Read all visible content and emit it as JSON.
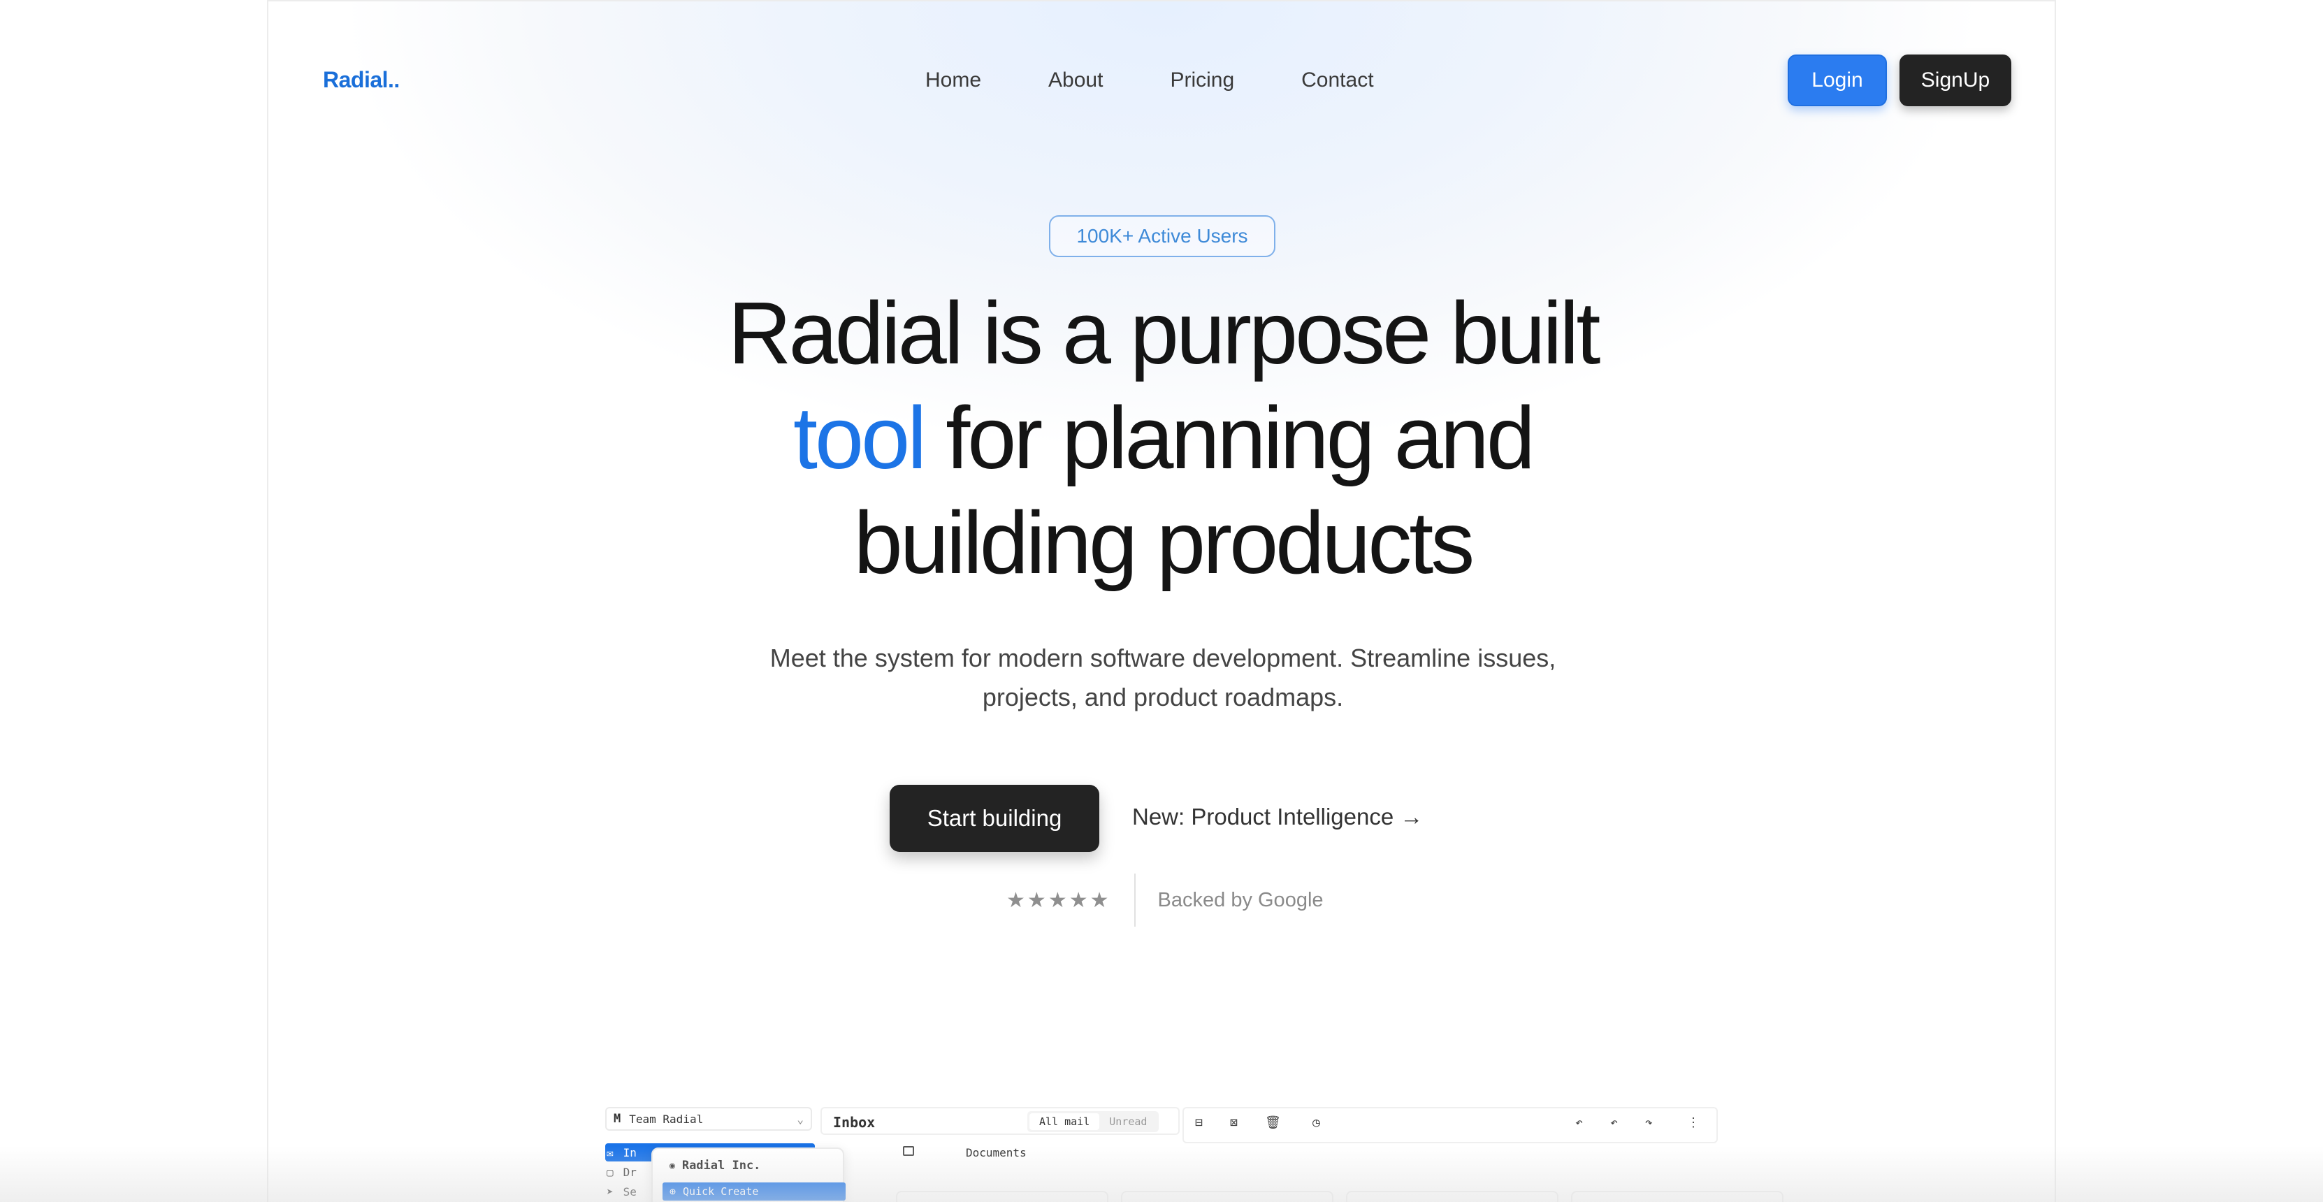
{
  "brand": {
    "logo": "Radial..",
    "accent": "#1c74e6"
  },
  "nav": {
    "links": [
      "Home",
      "About",
      "Pricing",
      "Contact"
    ],
    "login_label": "Login",
    "signup_label": "SignUp"
  },
  "hero": {
    "badge": "100K+ Active Users",
    "headline_line1": "Radial is a purpose built",
    "headline_accent": "tool",
    "headline_line2_rest": " for planning and",
    "headline_line3": "building products",
    "subtext": "Meet the system for modern software development. Streamline issues, projects, and product roadmaps.",
    "cta_primary": "Start building",
    "cta_secondary": "New: Product Intelligence →",
    "rating_stars": 5,
    "backed_by": "Backed by Google"
  },
  "preview": {
    "team_name": "Team Radial",
    "sidebar_items": [
      "In",
      "Dr",
      "Se"
    ],
    "popup_title": "Radial Inc.",
    "popup_item": "Quick Create",
    "inbox_title": "Inbox",
    "tabs": [
      "All mail",
      "Unread"
    ],
    "documents_label": "Documents"
  }
}
